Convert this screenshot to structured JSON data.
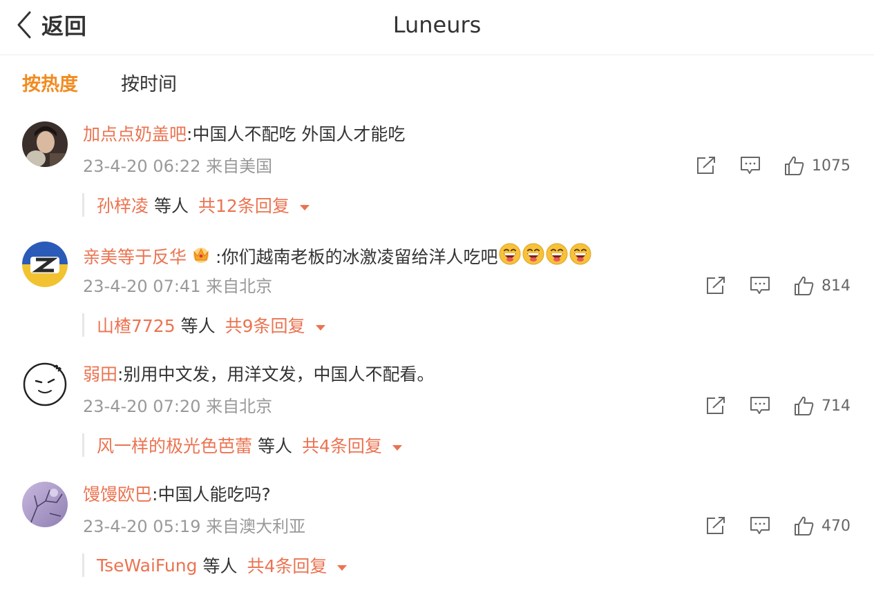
{
  "header": {
    "back_label": "返回",
    "title": "Luneurs"
  },
  "sort_tabs": [
    {
      "label": "按热度",
      "active": true
    },
    {
      "label": "按时间",
      "active": false
    }
  ],
  "colors": {
    "accent": "#f28b20",
    "username": "#eb7350",
    "meta": "#999999"
  },
  "comments": [
    {
      "user": "加点点奶盖吧",
      "text": ":中国人不配吃 外国人才能吃",
      "time": "23-4-20 06:22",
      "location": "来自美国",
      "likes": "1075",
      "reply_user": "孙梓凌",
      "reply_etc": "等人",
      "reply_count": "共12条回复"
    },
    {
      "user": "亲美等于反华",
      "has_crown": true,
      "text": ":你们越南老板的冰激凌留给洋人吃吧",
      "emoji_icon": "laughing-emoji-icon",
      "time": "23-4-20 07:41",
      "location": "来自北京",
      "likes": "814",
      "reply_user": "山楂7725",
      "reply_etc": "等人",
      "reply_count": "共9条回复"
    },
    {
      "user": "弱田",
      "text": ":别用中文发，用洋文发，中国人不配看。",
      "time": "23-4-20 07:20",
      "location": "来自北京",
      "likes": "714",
      "reply_user": "风一样的极光色芭蕾",
      "reply_etc": "等人",
      "reply_count": "共4条回复"
    },
    {
      "user": "馒馒欧巴",
      "text": ":中国人能吃吗?",
      "time": "23-4-20 05:19",
      "location": "来自澳大利亚",
      "likes": "470",
      "reply_user": "TseWaiFung",
      "reply_etc": "等人",
      "reply_count": "共4条回复"
    }
  ]
}
